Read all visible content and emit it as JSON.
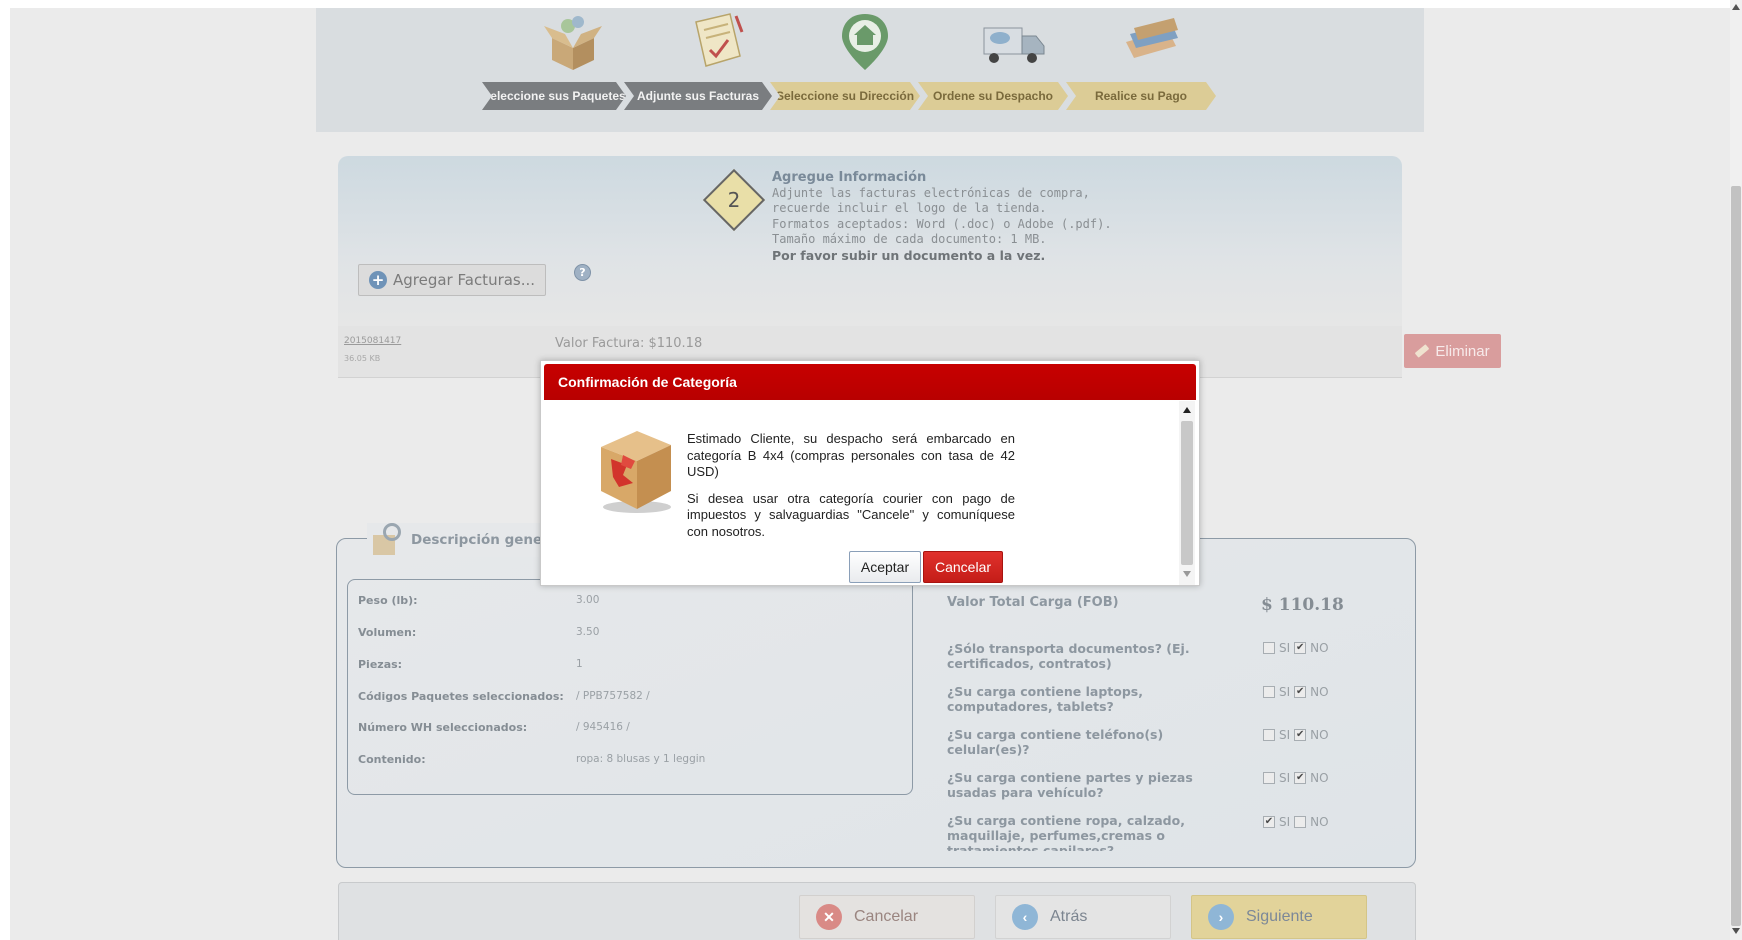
{
  "steps": [
    {
      "label": "Seleccione sus Paquetes",
      "icon": "open-box-icon",
      "status": "done"
    },
    {
      "label": "Adjunte sus Facturas",
      "icon": "invoice-document-icon",
      "status": "done"
    },
    {
      "label": "Seleccione su Dirección",
      "icon": "home-location-icon",
      "status": "pending"
    },
    {
      "label": "Ordene su Despacho",
      "icon": "delivery-truck-icon",
      "status": "pending"
    },
    {
      "label": "Realice su Pago",
      "icon": "credit-card-icon",
      "status": "pending"
    }
  ],
  "info": {
    "step_number": "2",
    "title": "Agregue Información",
    "lines": [
      "Adjunte las facturas electrónicas de compra,",
      "recuerde incluir el logo de la tienda.",
      "Formatos aceptados: Word (.doc) o Adobe (.pdf).",
      "Tamaño máximo de cada documento: 1 MB."
    ],
    "emphasis": "Por favor subir un documento a la vez.",
    "add_button": "Agregar Facturas...",
    "help": "?"
  },
  "invoice": {
    "name": "2015081417",
    "size": "36.05 KB",
    "value": "Valor Factura: $110.18",
    "delete_label": "Eliminar"
  },
  "description": {
    "heading": "Descripción general",
    "rows": [
      {
        "label": "Peso (lb):",
        "value": "3.00"
      },
      {
        "label": "Volumen:",
        "value": "3.50"
      },
      {
        "label": "Piezas:",
        "value": "1"
      },
      {
        "label": "Códigos Paquetes seleccionados:",
        "value": "/ PPB757582 /"
      },
      {
        "label": "Número WH seleccionados:",
        "value": "/ 945416 /"
      },
      {
        "label": "Contenido:",
        "value": "ropa: 8 blusas y 1 leggin"
      }
    ],
    "fob_label": "Valor Total Carga (FOB)",
    "fob_value": "$ 110.18",
    "yes_label": "SI",
    "no_label": "NO",
    "questions": [
      {
        "text": "¿Sólo transporta documentos? (Ej. certificados, contratos)",
        "answer": "NO"
      },
      {
        "text": "¿Su carga contiene laptops, computadores, tablets?",
        "answer": "NO"
      },
      {
        "text": "¿Su carga contiene teléfono(s) celular(es)?",
        "answer": "NO"
      },
      {
        "text": "¿Su carga contiene partes y piezas usadas para vehículo?",
        "answer": "NO"
      },
      {
        "text": "¿Su carga contiene ropa, calzado, maquillaje, perfumes,cremas o tratamientos capilares?",
        "answer": "SI"
      }
    ]
  },
  "bottom": {
    "cancel": "Cancelar",
    "back": "Atrás",
    "next": "Siguiente"
  },
  "modal": {
    "title": "Confirmación de Categoría",
    "paragraph1": "Estimado Cliente, su despacho será embarcado en categoría B 4x4 (compras personales con tasa de 42 USD)",
    "paragraph2": "Si desea usar otra categoría courier con pago de impuestos y salvaguardias \"Cancele\" y comuníquese con nosotros.",
    "accept": "Aceptar",
    "cancel": "Cancelar"
  },
  "colors": {
    "modal_header": "#c70000",
    "cancel_button": "#d42520",
    "overlay": "#ebebeb"
  }
}
